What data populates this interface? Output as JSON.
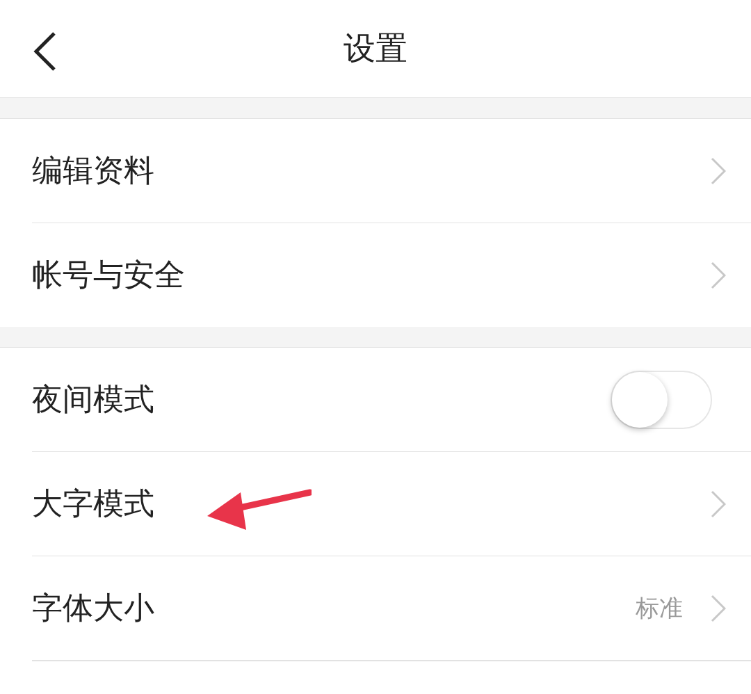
{
  "header": {
    "title": "设置"
  },
  "groups": [
    {
      "rows": [
        {
          "kind": "link",
          "label": "编辑资料"
        },
        {
          "kind": "link",
          "label": "帐号与安全"
        }
      ]
    },
    {
      "rows": [
        {
          "kind": "toggle",
          "label": "夜间模式",
          "on": false
        },
        {
          "kind": "link",
          "label": "大字模式",
          "annotated": true
        },
        {
          "kind": "value",
          "label": "字体大小",
          "value": "标准"
        }
      ]
    }
  ]
}
